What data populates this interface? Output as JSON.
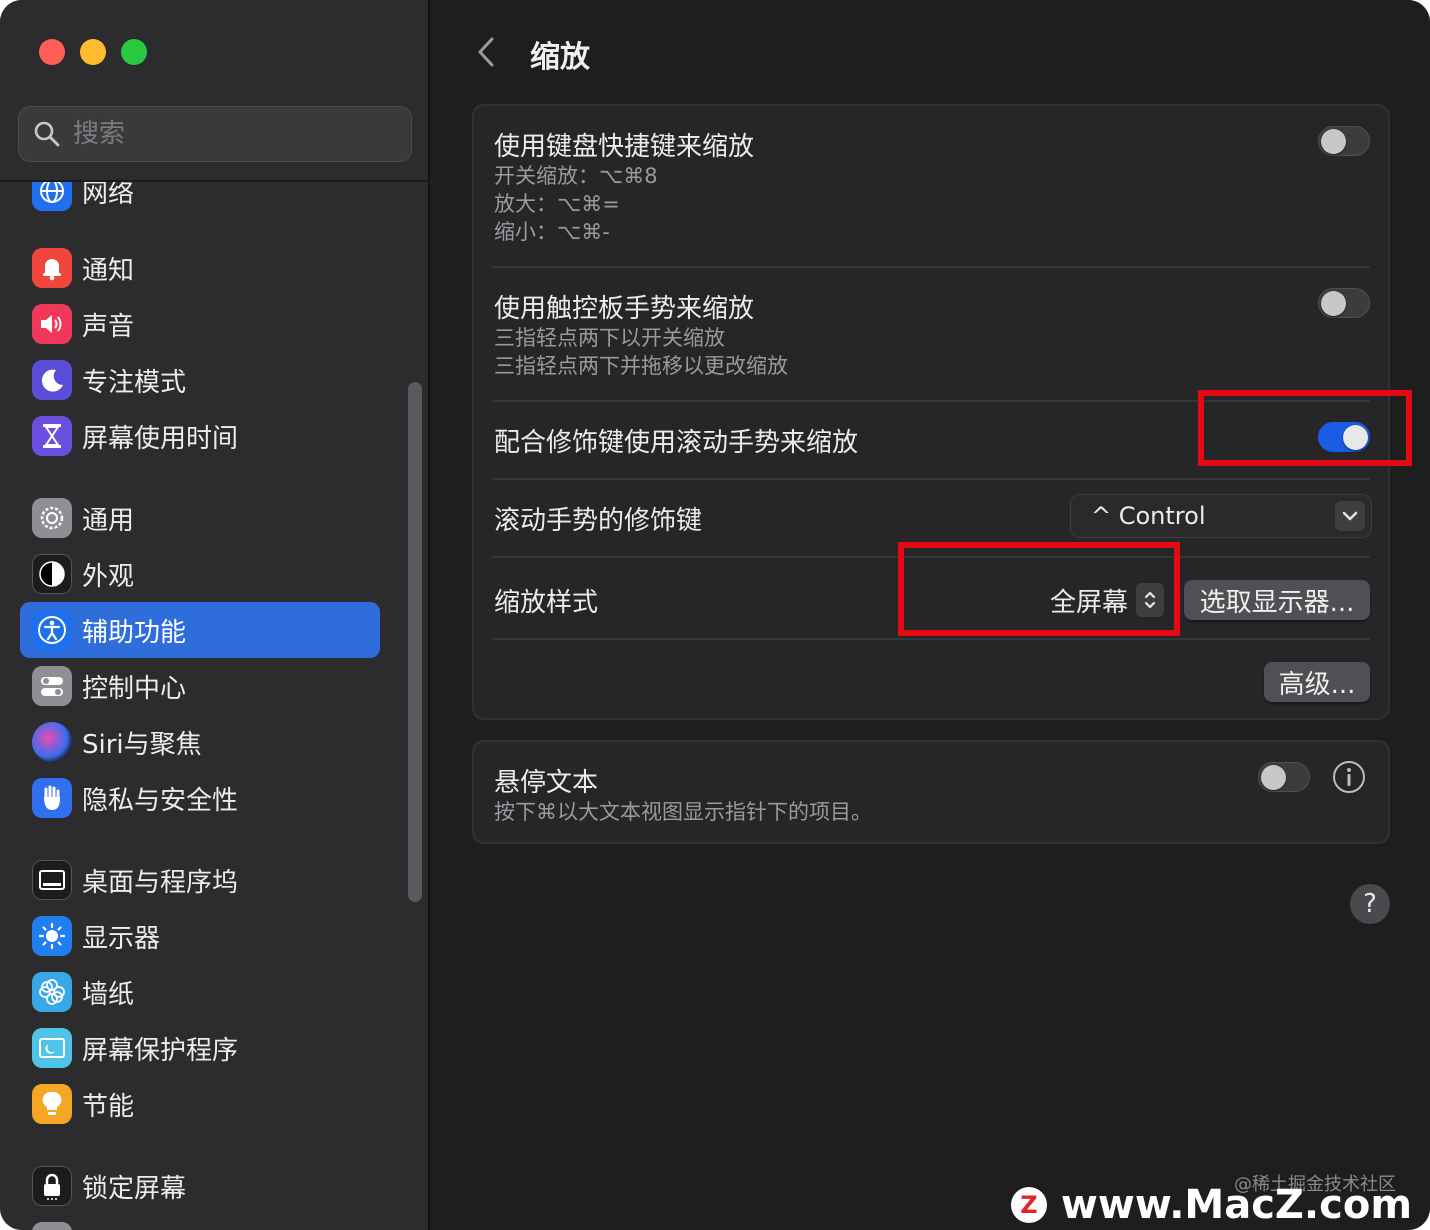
{
  "window": {
    "traffic_lights": [
      "close",
      "minimize",
      "zoom"
    ]
  },
  "search": {
    "placeholder": "搜索"
  },
  "sidebar": {
    "items": [
      {
        "label": "网络",
        "icon": "globe-icon",
        "color": "#1f6ff0"
      },
      {
        "label": "通知",
        "icon": "bell-icon",
        "color": "#f0453a"
      },
      {
        "label": "声音",
        "icon": "speaker-icon",
        "color": "#f0385a"
      },
      {
        "label": "专注模式",
        "icon": "moon-icon",
        "color": "#5b4dd6"
      },
      {
        "label": "屏幕使用时间",
        "icon": "hourglass-icon",
        "color": "#6b4fe0"
      },
      {
        "label": "通用",
        "icon": "gear-icon",
        "color": "#8e8e93"
      },
      {
        "label": "外观",
        "icon": "appearance-icon",
        "color": "#1c1c1e"
      },
      {
        "label": "辅助功能",
        "icon": "accessibility-icon",
        "color": "#1f6ff0"
      },
      {
        "label": "控制中心",
        "icon": "toggles-icon",
        "color": "#8e8e93"
      },
      {
        "label": "Siri与聚焦",
        "icon": "siri-icon",
        "color": "#2a2a8a"
      },
      {
        "label": "隐私与安全性",
        "icon": "hand-icon",
        "color": "#2f6ff0"
      },
      {
        "label": "桌面与程序坞",
        "icon": "dock-icon",
        "color": "#1c1c1e"
      },
      {
        "label": "显示器",
        "icon": "sun-icon",
        "color": "#1f7ff0"
      },
      {
        "label": "墙纸",
        "icon": "flower-icon",
        "color": "#3aa7e8"
      },
      {
        "label": "屏幕保护程序",
        "icon": "screensaver-icon",
        "color": "#4fc3e8"
      },
      {
        "label": "节能",
        "icon": "bulb-icon",
        "color": "#f5a623"
      },
      {
        "label": "锁定屏幕",
        "icon": "lock-screen-icon",
        "color": "#1c1c1e"
      }
    ],
    "active": "辅助功能"
  },
  "header": {
    "title": "缩放"
  },
  "zoom_group": {
    "keyboard": {
      "title": "使用键盘快捷键来缩放",
      "lines": [
        "开关缩放：⌥⌘8",
        "放大：⌥⌘=",
        "缩小：⌥⌘-"
      ],
      "enabled": false
    },
    "trackpad": {
      "title": "使用触控板手势来缩放",
      "lines": [
        "三指轻点两下以开关缩放",
        "三指轻点两下并拖移以更改缩放"
      ],
      "enabled": false
    },
    "scroll": {
      "title": "配合修饰键使用滚动手势来缩放",
      "enabled": true
    },
    "modifier": {
      "title": "滚动手势的修饰键",
      "value": "^ Control"
    },
    "style": {
      "title": "缩放样式",
      "value": "全屏幕",
      "choose_display": "选取显示器..."
    },
    "advanced": "高级..."
  },
  "hover_group": {
    "title": "悬停文本",
    "subtitle": "按下⌘以大文本视图显示指针下的项目。",
    "enabled": false
  },
  "help": "?",
  "watermark": {
    "logo": "Z",
    "text": "www.MacZ.com",
    "small": "@稀土掘金技术社区"
  },
  "colors": {
    "accent": "#2f6ddb",
    "toggle_on": "#1a5ce6",
    "highlight": "#e50914"
  }
}
